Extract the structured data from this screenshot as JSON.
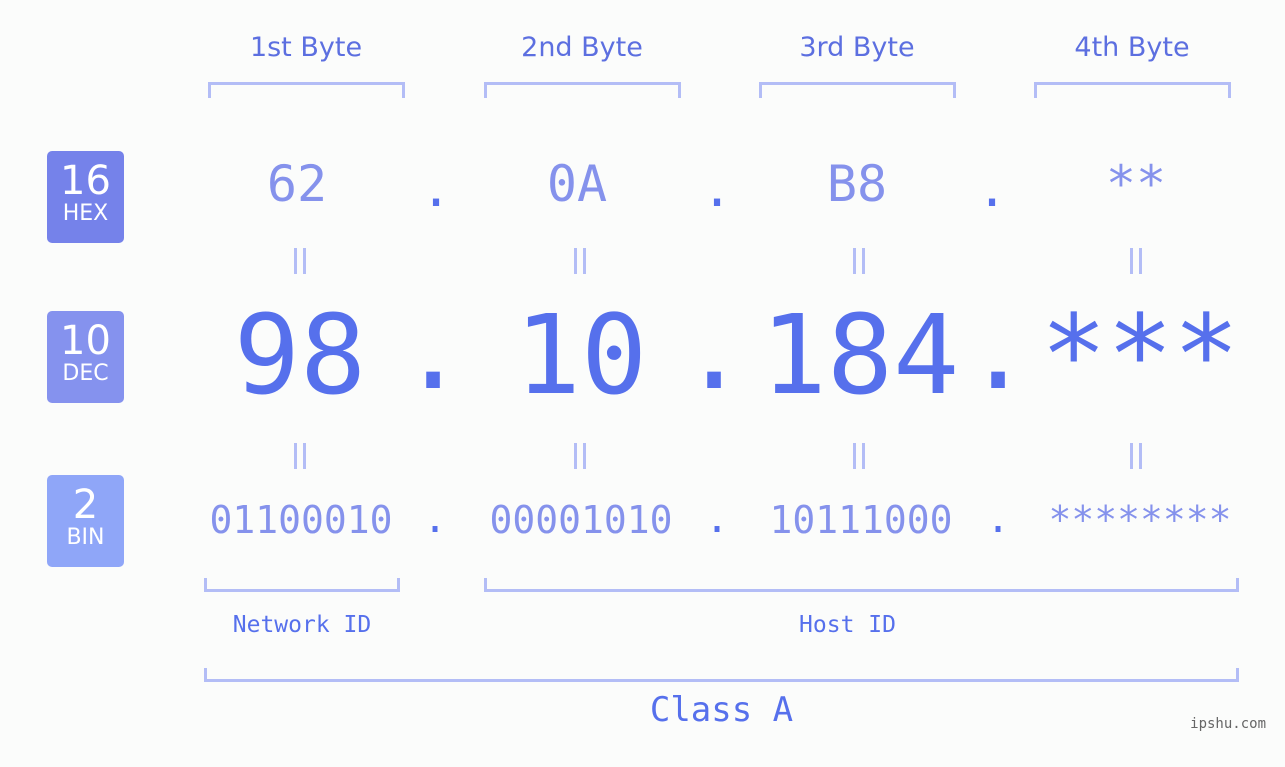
{
  "byte_headers": [
    "1st Byte",
    "2nd Byte",
    "3rd Byte",
    "4th Byte"
  ],
  "rows": {
    "hex": {
      "base": "16",
      "label": "HEX",
      "values": [
        "62",
        "0A",
        "B8",
        "**"
      ],
      "color": "#7582ea"
    },
    "dec": {
      "base": "10",
      "label": "DEC",
      "values": [
        "98",
        "10",
        "184",
        "***"
      ],
      "color": "#8592ee"
    },
    "bin": {
      "base": "2",
      "label": "BIN",
      "values": [
        "01100010",
        "00001010",
        "10111000",
        "********"
      ],
      "color": "#8fa6f8"
    }
  },
  "separator": ".",
  "equals_symbol": "=",
  "network_id_label": "Network ID",
  "host_id_label": "Host ID",
  "class_label": "Class A",
  "footer": "ipshu.com",
  "colors": {
    "primary": "#5670ec",
    "secondary": "#8592ec",
    "bracket": "#b3bdf6",
    "background": "#fbfcfb"
  }
}
